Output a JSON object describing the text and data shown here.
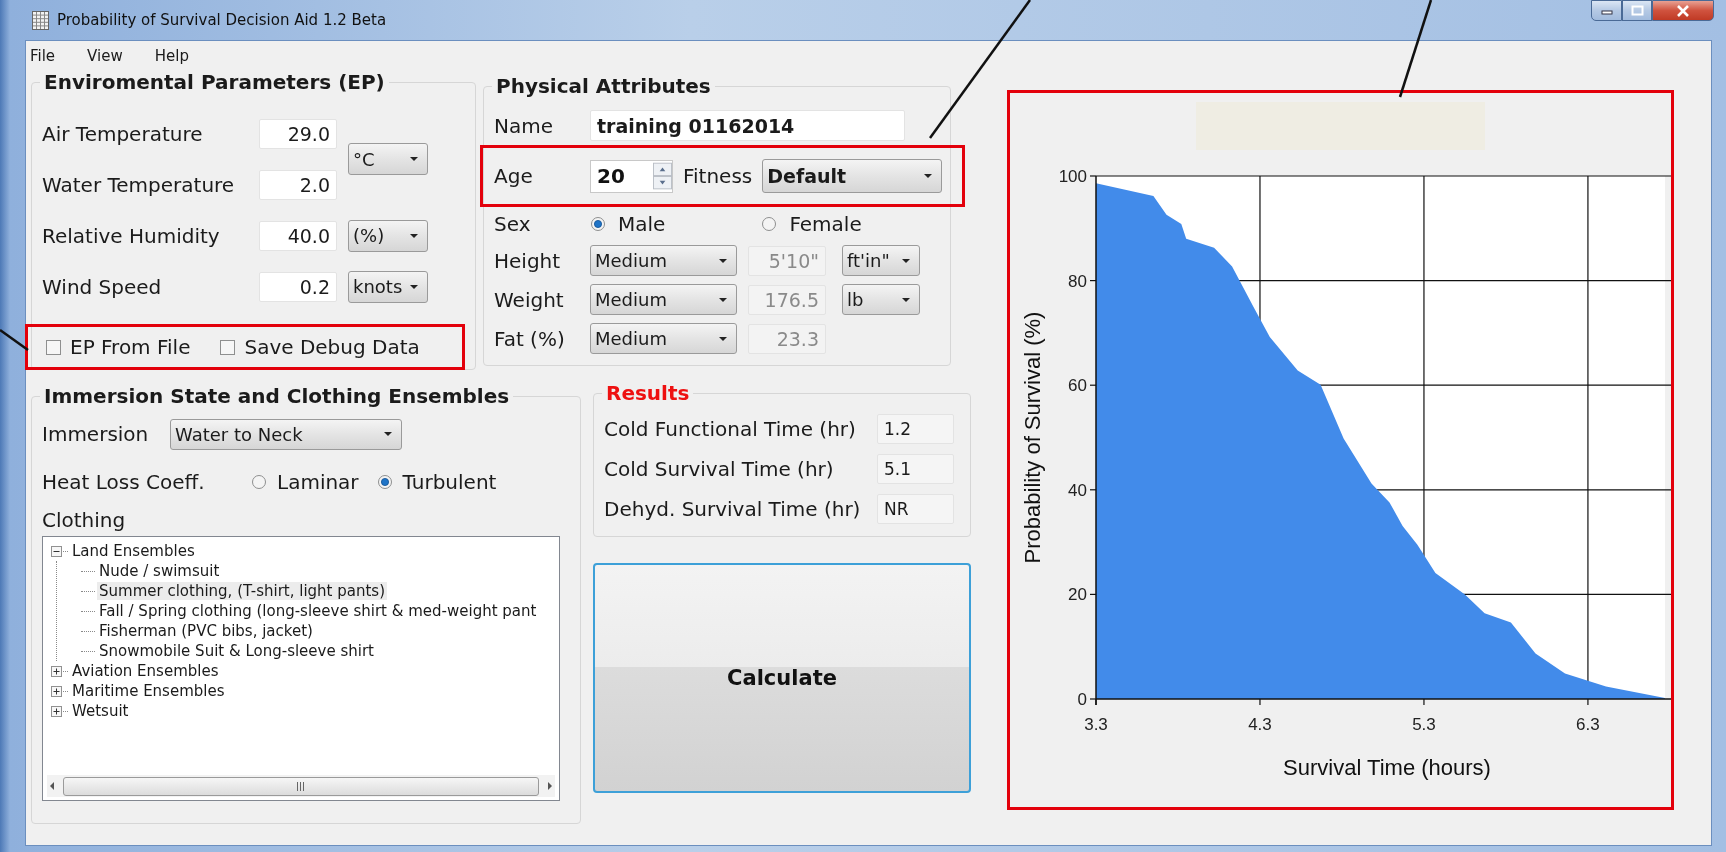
{
  "window": {
    "title": "Probability of Survival Decision Aid 1.2 Beta"
  },
  "menu": [
    {
      "label": "File"
    },
    {
      "label": "View"
    },
    {
      "label": "Help"
    }
  ],
  "environmental_parameters": {
    "title": "Enviromental Parameters (EP)",
    "fields": [
      {
        "label": "Air Temperature",
        "value": "29.0"
      },
      {
        "label": "Water Temperature",
        "value": "2.0"
      },
      {
        "label": "Relative Humidity",
        "value": "40.0",
        "unit": "(%)"
      },
      {
        "label": "Wind Speed",
        "value": "0.2",
        "unit": "knots"
      }
    ],
    "temperature_unit": "°C",
    "checkboxes": [
      {
        "label": "EP From File",
        "checked": false
      },
      {
        "label": "Save Debug Data",
        "checked": false
      }
    ]
  },
  "physical_attributes": {
    "title": "Physical Attributes",
    "name": {
      "label": "Name",
      "value": "training 01162014"
    },
    "age": {
      "label": "Age",
      "value": "20"
    },
    "fitness": {
      "label": "Fitness",
      "value": "Default"
    },
    "sex": {
      "label": "Sex",
      "options": [
        {
          "label": "Male",
          "selected": true
        },
        {
          "label": "Female",
          "selected": false
        }
      ]
    },
    "measures": [
      {
        "label": "Height",
        "category": "Medium",
        "value": "5'10\"",
        "disabled": true,
        "unit": "ft'in\""
      },
      {
        "label": "Weight",
        "category": "Medium",
        "value": "176.5",
        "disabled": true,
        "unit": "lb"
      },
      {
        "label": "Fat (%)",
        "category": "Medium",
        "value": "23.3",
        "disabled": true
      }
    ]
  },
  "immersion_state": {
    "title": "Immersion State and Clothing Ensembles",
    "immersion": {
      "label": "Immersion",
      "value": "Water to Neck"
    },
    "heat_loss": {
      "label": "Heat Loss Coeff.",
      "options": [
        {
          "label": "Laminar",
          "selected": false
        },
        {
          "label": "Turbulent",
          "selected": true
        }
      ]
    },
    "clothing": {
      "label": "Clothing",
      "items": [
        {
          "label": "Land Ensembles",
          "expanded": true,
          "selected": false,
          "children": [
            {
              "label": "Nude / swimsuit",
              "selected": false
            },
            {
              "label": "Summer clothing, (T-shirt, light pants)",
              "selected": true
            },
            {
              "label": "Fall / Spring clothing (long-sleeve shirt & med-weight pant",
              "selected": false
            },
            {
              "label": "Fisherman (PVC bibs, jacket)",
              "selected": false
            },
            {
              "label": "Snowmobile Suit & Long-sleeve shirt",
              "selected": false
            }
          ]
        },
        {
          "label": "Aviation Ensembles",
          "expanded": false,
          "selected": false
        },
        {
          "label": "Maritime Ensembles",
          "expanded": false,
          "selected": false
        },
        {
          "label": "Wetsuit",
          "expanded": false,
          "selected": false
        }
      ]
    }
  },
  "results": {
    "title": "Results",
    "rows": [
      {
        "label": "Cold Functional Time (hr)",
        "value": "1.2"
      },
      {
        "label": "Cold Survival Time (hr)",
        "value": "5.1"
      },
      {
        "label": "Dehyd. Survival Time (hr)",
        "value": "NR"
      }
    ]
  },
  "calculate_button": {
    "label": "Calculate"
  },
  "survival_chart": {
    "chart_data": {
      "type": "area",
      "xlabel": "Survival Time (hours)",
      "ylabel": "Probability of Survival (%)",
      "grid": true,
      "x": [
        3.3,
        3.65,
        3.73,
        3.82,
        3.85,
        4.02,
        4.13,
        4.26,
        4.36,
        4.53,
        4.67,
        4.81,
        4.98,
        5.09,
        5.17,
        5.26,
        5.37,
        5.55,
        5.67,
        5.83,
        5.98,
        6.16,
        6.41,
        6.77
      ],
      "series": [
        {
          "color": "#428bea",
          "values": [
            98.6,
            96.2,
            92.6,
            90.8,
            88,
            86.3,
            82.7,
            75,
            69.2,
            62.8,
            60.1,
            49.8,
            41.2,
            37.6,
            33.1,
            29.5,
            24.1,
            20,
            16.4,
            14.6,
            8.7,
            4.9,
            2.4,
            0.2
          ]
        }
      ],
      "xlim": [
        3.3,
        6.77
      ],
      "ylim": [
        0,
        100
      ],
      "xticks": [
        3.3,
        4.3,
        5.3,
        6.3
      ],
      "yticks": [
        0,
        20,
        40,
        60,
        80,
        100
      ]
    }
  }
}
